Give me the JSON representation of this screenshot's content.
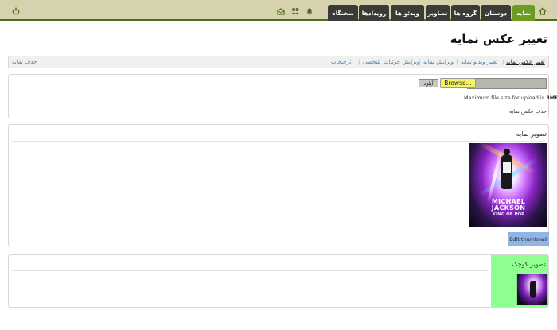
{
  "topbar": {
    "icons": {
      "home": "home-icon",
      "power": "power-icon",
      "bell": "bell-icon",
      "users": "users-icon",
      "mail": "mail-icon"
    },
    "tabs": [
      {
        "label": "نمایه",
        "active": true
      },
      {
        "label": "دوستان",
        "active": false
      },
      {
        "label": "گروه ها",
        "active": false
      },
      {
        "label": "تصاویر",
        "active": false
      },
      {
        "label": "ویدئو ها",
        "active": false
      },
      {
        "label": "رویدادها",
        "active": false
      },
      {
        "label": "سخنگاه",
        "active": false
      }
    ],
    "colors": {
      "bar": "#d6d2ae",
      "accent": "#4a6f18",
      "tab": "#3a3a36",
      "tab_active": "#6d9a23"
    }
  },
  "page": {
    "title": "تغییر عکس نمایه"
  },
  "subtabs": {
    "items": [
      {
        "label": "تغییر عکس نمایه",
        "active": true
      },
      {
        "label": "تغییر ویدئو نمایه",
        "active": false
      },
      {
        "label": "ویرایش نمایه",
        "active": false
      },
      {
        "label": "ویرایش جزئیات",
        "active": false
      },
      {
        "label": "شخصی",
        "active": false
      },
      {
        "label": "ترجیحات",
        "active": false
      }
    ],
    "delete_profile": "حذف نمایه"
  },
  "upload": {
    "browse_label": "Browse...",
    "upload_label": "آپلود",
    "max_size_text": "Maximum file size for upload is",
    "max_size_value": "3MB",
    "delete_photo": "حذف عکس نمایه"
  },
  "profile_image": {
    "title": "تصویر نمایه",
    "album_line1": "MICHAEL",
    "album_line2": "JACKSON",
    "album_line3": "KING OF POP",
    "edit_thumbnail": "Edit thumbnail"
  },
  "small_image": {
    "title": "تصویر کوچک"
  }
}
